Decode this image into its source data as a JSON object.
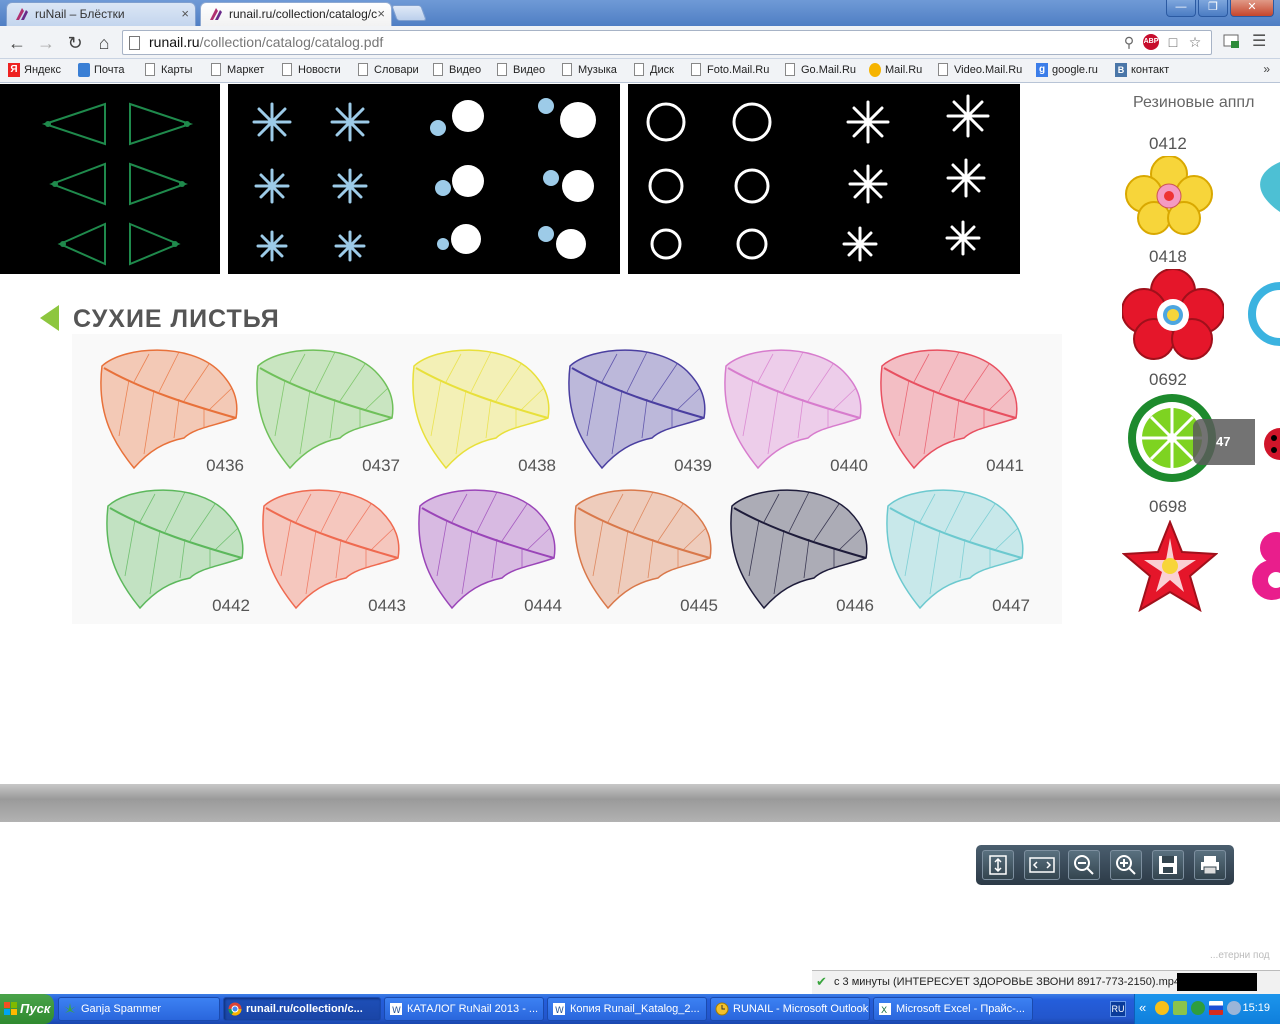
{
  "browser": {
    "tabs": [
      {
        "title": "ruNail – Блёстки",
        "close": "×"
      },
      {
        "title": "runail.ru/collection/catalog/c",
        "close": "×"
      }
    ],
    "window_buttons": {
      "minimize": "—",
      "restore": "❐",
      "close": "✕"
    },
    "nav": {
      "back": "←",
      "forward": "→",
      "reload": "↻",
      "home": "⌂"
    },
    "url_host": "runail.ru",
    "url_path": "/collection/catalog/catalog.pdf",
    "abp_label": "ABP",
    "bookmarks": [
      {
        "label": "Яндекс",
        "icon": "yandex-icon"
      },
      {
        "label": "Почта",
        "icon": "mail-icon"
      },
      {
        "label": "Карты",
        "icon": "page-icon"
      },
      {
        "label": "Маркет",
        "icon": "page-icon"
      },
      {
        "label": "Новости",
        "icon": "page-icon"
      },
      {
        "label": "Словари",
        "icon": "page-icon"
      },
      {
        "label": "Видео",
        "icon": "page-icon"
      },
      {
        "label": "Видео",
        "icon": "page-icon"
      },
      {
        "label": "Музыка",
        "icon": "page-icon"
      },
      {
        "label": "Диск",
        "icon": "page-icon"
      },
      {
        "label": "Foto.Mail.Ru",
        "icon": "page-icon"
      },
      {
        "label": "Go.Mail.Ru",
        "icon": "page-icon"
      },
      {
        "label": "Mail.Ru",
        "icon": "mailru-icon"
      },
      {
        "label": "Video.Mail.Ru",
        "icon": "page-icon"
      },
      {
        "label": "google.ru",
        "icon": "google-icon"
      },
      {
        "label": "контакт",
        "icon": "vk-icon"
      }
    ],
    "bookmarks_more": "»"
  },
  "pdf": {
    "section_title": "СУХИЕ ЛИСТЬЯ",
    "leaves_row1": [
      {
        "code": "0436",
        "color": "#e8713a"
      },
      {
        "code": "0437",
        "color": "#6fc05a"
      },
      {
        "code": "0438",
        "color": "#e8e03a"
      },
      {
        "code": "0439",
        "color": "#4a3fa0"
      },
      {
        "code": "0440",
        "color": "#d77ccd"
      },
      {
        "code": "0441",
        "color": "#e85060"
      }
    ],
    "leaves_row2": [
      {
        "code": "0442",
        "color": "#5cb85c"
      },
      {
        "code": "0443",
        "color": "#ef6a50"
      },
      {
        "code": "0444",
        "color": "#9a45b8"
      },
      {
        "code": "0445",
        "color": "#d9784a"
      },
      {
        "code": "0446",
        "color": "#1e1c3a"
      },
      {
        "code": "0447",
        "color": "#6cc9cf"
      }
    ],
    "side_header": "Резиновые аппл",
    "side_codes": [
      "0412",
      "0418",
      "0692",
      "0698"
    ],
    "page_number": "47",
    "ghost_text": "...етерни под"
  },
  "download": {
    "text": "с 3 минуты (ИНТЕРЕСУЕТ ЗДОРОВЬЕ  ЗВОНИ 8917-773-2150).mp4"
  },
  "taskbar": {
    "start": "Пуск",
    "tasks": [
      {
        "label": "Ganja Spammer",
        "icon": "cannabis-leaf-icon"
      },
      {
        "label": "runail.ru/collection/c...",
        "icon": "chrome-icon"
      },
      {
        "label": "КАТАЛОГ RuNail 2013 - ...",
        "icon": "word-icon"
      },
      {
        "label": "Копия Runail_Katalog_2...",
        "icon": "word-icon"
      },
      {
        "label": "RUNAIL - Microsoft Outlook",
        "icon": "outlook-icon"
      },
      {
        "label": "Microsoft Excel - Прайс-...",
        "icon": "excel-icon"
      }
    ],
    "lang": "RU",
    "clock": "15:19"
  },
  "colors": {
    "accent_green": "#8dc63f",
    "taskbar_blue": "#245edb"
  }
}
